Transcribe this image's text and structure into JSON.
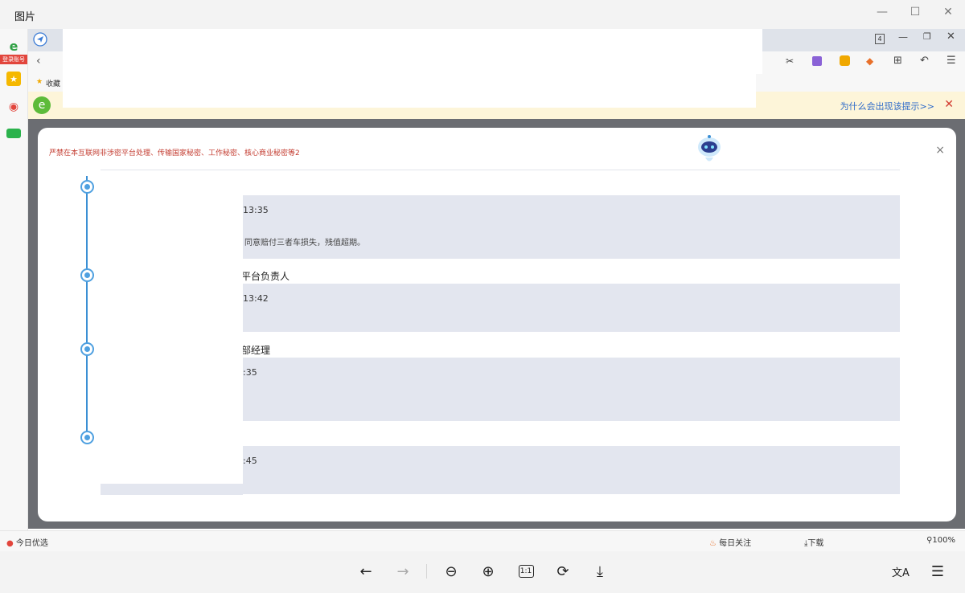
{
  "window": {
    "title": "图片",
    "controls": {
      "minimize": "—",
      "maximize": "☐",
      "close": "✕"
    }
  },
  "browser": {
    "login_badge": "登录账号",
    "tab_count": "4",
    "favorites_label": "收藏",
    "warning_link": "为什么会出现该提示>>",
    "warning_close": "✕"
  },
  "dialog": {
    "notice": "严禁在本互联网非涉密平台处理、传输国家秘密、工作秘密、核心商业秘密等2",
    "close": "×",
    "entries": [
      {
        "role": "",
        "time": "13:35",
        "comment": "同意赔付三者车损失，残值超期。"
      },
      {
        "role": "平台负责人",
        "time": "13:42",
        "comment": ""
      },
      {
        "role": "部经理",
        "time": ":35",
        "comment": ""
      },
      {
        "role": "",
        "time": ":45",
        "comment": ""
      }
    ]
  },
  "statusbar": {
    "today_deals": "今日优选",
    "daily_follow": "每日关注",
    "download": "下载",
    "zoom": "100%"
  },
  "toolbar": {
    "prev": "←",
    "next": "→",
    "zoom_out": "⊖",
    "zoom_in": "⊕",
    "actual_size": "1:1",
    "rotate": "⟳",
    "save": "⤓",
    "translate": "文A",
    "ocr": "☰"
  },
  "colors": {
    "timeline": "#3b8fd4",
    "card_bg": "#e3e6ef",
    "notice_red": "#c33b2f",
    "link_blue": "#2f6bc9",
    "warn_bg": "#fdf5d9"
  }
}
